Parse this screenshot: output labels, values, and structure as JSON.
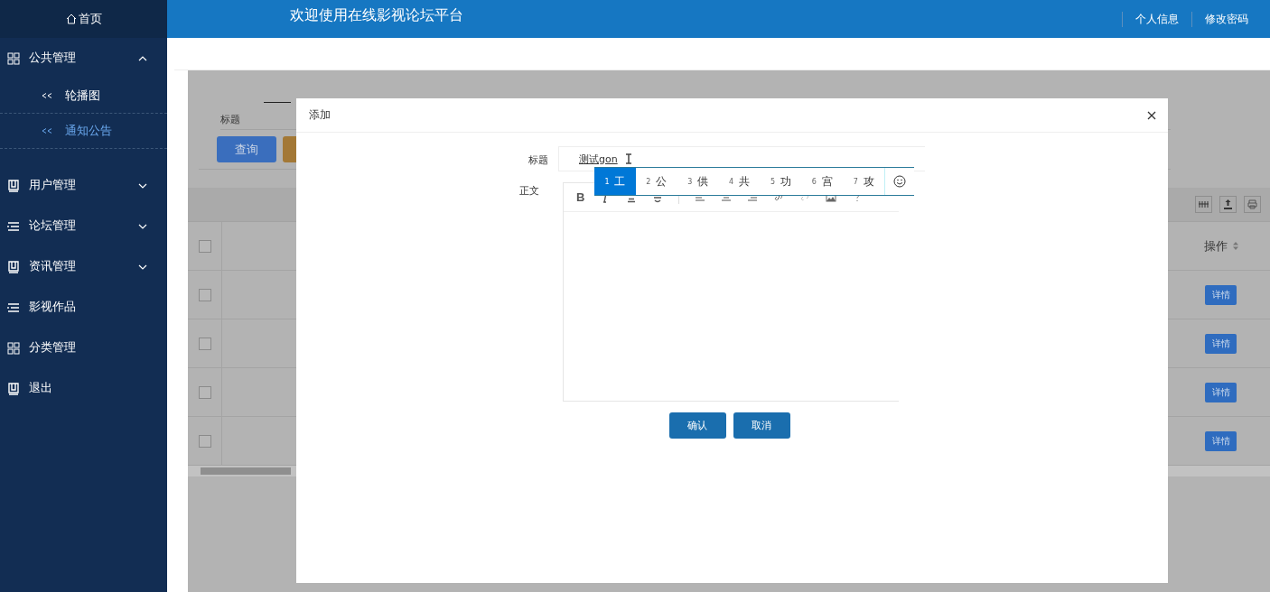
{
  "sidebar": {
    "home": "首页",
    "items": [
      {
        "label": "公共管理",
        "kind": "group",
        "expanded": true,
        "children": [
          {
            "label": "轮播图",
            "selected": false
          },
          {
            "label": "通知公告",
            "selected": true
          }
        ]
      },
      {
        "label": "用户管理",
        "kind": "group",
        "expanded": false
      },
      {
        "label": "论坛管理",
        "kind": "group",
        "expanded": false
      },
      {
        "label": "资讯管理",
        "kind": "group",
        "expanded": false
      },
      {
        "label": "影视作品",
        "kind": "link"
      },
      {
        "label": "分类管理",
        "kind": "link"
      },
      {
        "label": "退出",
        "kind": "link"
      }
    ]
  },
  "header": {
    "title": "欢迎使用在线影视论坛平台",
    "links": [
      "个人信息",
      "修改密码"
    ]
  },
  "search": {
    "label": "标题",
    "buttons": [
      {
        "label": "查询",
        "color": "#3a6ebd"
      },
      {
        "color": "#a37836"
      }
    ]
  },
  "table": {
    "select_all": {
      "checked": false
    },
    "action_header": "操作",
    "rows": [
      {
        "checked": false,
        "action": "详情"
      },
      {
        "checked": false,
        "action": "详情"
      },
      {
        "checked": false,
        "action": "详情"
      },
      {
        "checked": false,
        "action": "详情"
      }
    ]
  },
  "dialog": {
    "title": "添加",
    "fields": [
      {
        "label": "标题",
        "kind": "text",
        "value": "测试gon"
      },
      {
        "label": "正文",
        "kind": "editor",
        "toolbar": [
          "B"
        ]
      }
    ],
    "ime": {
      "candidates": [
        {
          "index": "1",
          "text": "工",
          "selected": true
        },
        {
          "index": "2",
          "text": "公",
          "selected": false
        },
        {
          "index": "3",
          "text": "供",
          "selected": false
        },
        {
          "index": "4",
          "text": "共",
          "selected": false
        },
        {
          "index": "5",
          "text": "功",
          "selected": false
        },
        {
          "index": "6",
          "text": "宫",
          "selected": false
        },
        {
          "index": "7",
          "text": "攻",
          "selected": false
        }
      ]
    },
    "buttons": [
      "确认",
      "取消"
    ]
  }
}
